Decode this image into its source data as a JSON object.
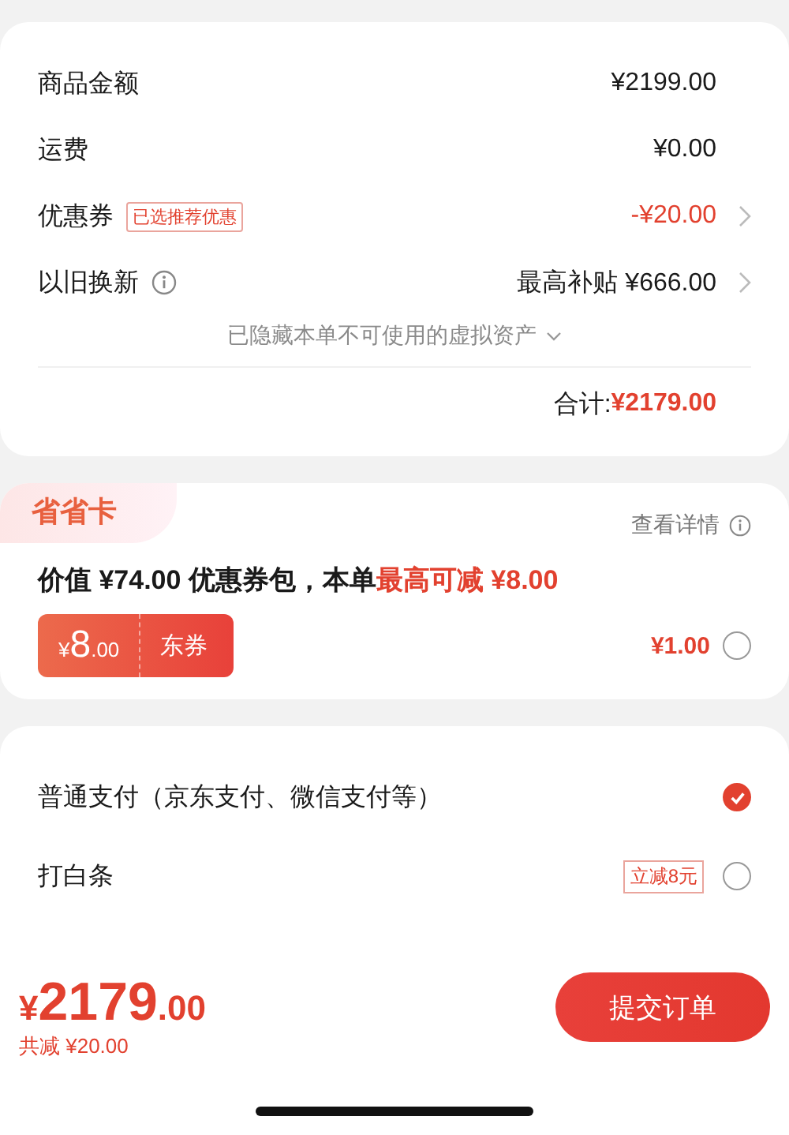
{
  "summary": {
    "rows": [
      {
        "label": "商品金额",
        "value": "¥2199.00",
        "discount": false,
        "info": false,
        "navigable": false
      },
      {
        "label": "运费",
        "value": "¥0.00",
        "discount": false,
        "info": false,
        "navigable": false
      },
      {
        "label": "优惠券",
        "badge": "已选推荐优惠",
        "value": "-¥20.00",
        "discount": true,
        "info": false,
        "navigable": true
      },
      {
        "label": "以旧换新",
        "value": "最高补贴 ¥666.00",
        "discount": false,
        "info": true,
        "navigable": true
      }
    ],
    "hidden_note": "已隐藏本单不可使用的虚拟资产",
    "total_label": "合计:",
    "total_value": "¥2179.00"
  },
  "saver_card": {
    "tab": "省省卡",
    "details_link": "查看详情",
    "headline": "价值 ¥74.00 优惠券包，本单**最高可减 ¥8.00**",
    "coupon": {
      "currency": "¥",
      "amount": "8",
      "decimals": ".00",
      "label": "东券"
    },
    "price": "¥1.00",
    "selected": false
  },
  "payment": {
    "options": [
      {
        "label": "普通支付（京东支付、微信支付等）",
        "selected": true
      },
      {
        "label": "打白条",
        "badge": "立减8元",
        "selected": false
      }
    ]
  },
  "footer": {
    "currency": "¥",
    "amount": "2179",
    "decimals": ".00",
    "saving": "共减 ¥20.00",
    "submit": "提交订单"
  }
}
